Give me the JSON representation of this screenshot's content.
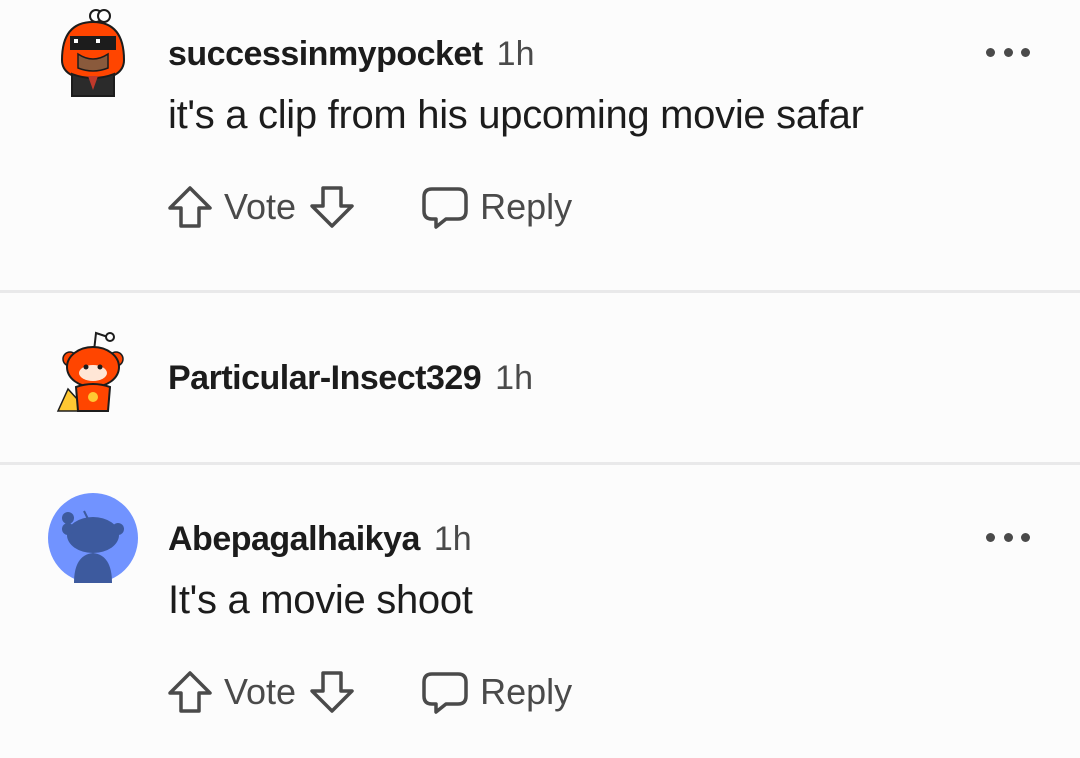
{
  "comments": [
    {
      "username": "successinmypocket",
      "time": "1h",
      "text": "it's a clip from his upcoming movie safar",
      "avatar": "orange-hooded-snoo-with-pixel-sunglasses",
      "vote_label": "Vote",
      "reply_label": "Reply"
    },
    {
      "username": "Particular-Insect329",
      "time": "1h",
      "avatar": "red-snoo-with-yellow-cape"
    },
    {
      "username": "Abepagalhaikya",
      "time": "1h",
      "text": "It's a movie shoot",
      "avatar": "default-blue-snoo",
      "vote_label": "Vote",
      "reply_label": "Reply"
    }
  ],
  "colors": {
    "background": "#fcfcfc",
    "divider": "#e9e9ea",
    "text_primary": "#1c1c1c",
    "text_secondary": "#4a4a4a",
    "snoo_orange": "#ff4500",
    "avatar_blue": "#7193ff"
  },
  "icons": [
    "upvote-arrow-icon",
    "downvote-arrow-icon",
    "comment-bubble-icon",
    "more-options-icon"
  ]
}
